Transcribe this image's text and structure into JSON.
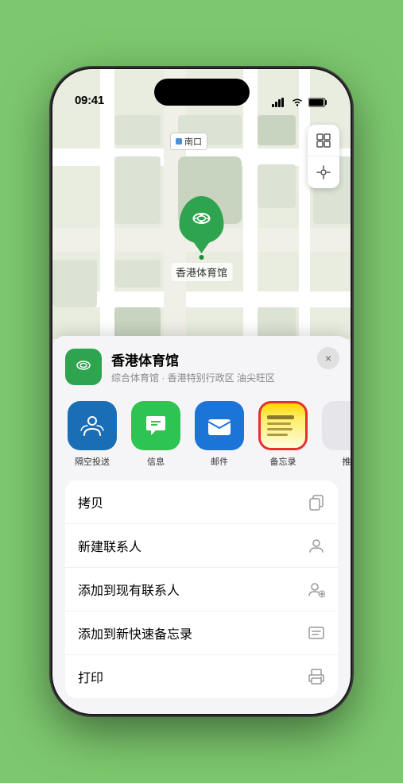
{
  "statusBar": {
    "time": "09:41",
    "signal": "●●●●",
    "wifi": "WiFi",
    "battery": "Battery"
  },
  "map": {
    "label": "南口",
    "mapIconLabel": "地图",
    "locationLabel": "定位"
  },
  "marker": {
    "name": "香港体育馆",
    "dot": "●"
  },
  "locationCard": {
    "name": "香港体育馆",
    "subtitle": "综合体育馆 · 香港特别行政区 油尖旺区",
    "closeLabel": "×"
  },
  "shareActions": [
    {
      "id": "airdrop",
      "label": "隔空投送",
      "icon": "airdrop"
    },
    {
      "id": "messages",
      "label": "信息",
      "icon": "messages"
    },
    {
      "id": "mail",
      "label": "邮件",
      "icon": "mail"
    },
    {
      "id": "notes",
      "label": "备忘录",
      "icon": "notes"
    },
    {
      "id": "more",
      "label": "推",
      "icon": "more"
    }
  ],
  "actionItems": [
    {
      "id": "copy",
      "label": "拷贝",
      "icon": "copy"
    },
    {
      "id": "new-contact",
      "label": "新建联系人",
      "icon": "new-contact"
    },
    {
      "id": "add-contact",
      "label": "添加到现有联系人",
      "icon": "add-contact"
    },
    {
      "id": "quick-note",
      "label": "添加到新快速备忘录",
      "icon": "quick-note"
    },
    {
      "id": "print",
      "label": "打印",
      "icon": "print"
    }
  ]
}
